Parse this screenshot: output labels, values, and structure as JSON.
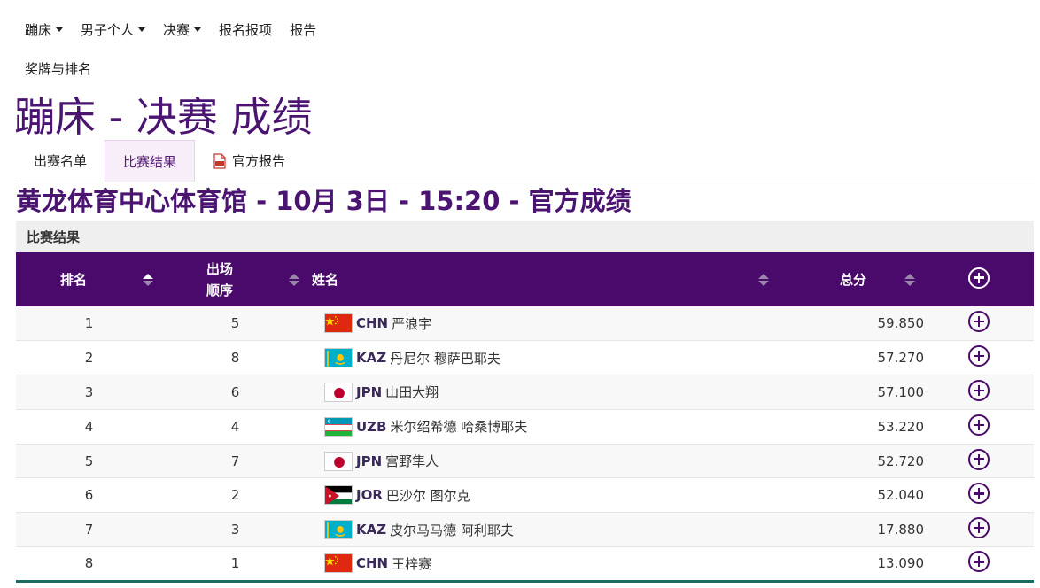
{
  "nav": {
    "items": [
      {
        "label": "蹦床",
        "dropdown": true
      },
      {
        "label": "男子个人",
        "dropdown": true
      },
      {
        "label": "决赛",
        "dropdown": true
      },
      {
        "label": "报名报项",
        "dropdown": false
      },
      {
        "label": "报告",
        "dropdown": false
      }
    ],
    "sub": "奖牌与排名"
  },
  "page_title": "蹦床 - 决赛 成绩",
  "tabs": [
    {
      "label": "出赛名单",
      "active": false
    },
    {
      "label": "比赛结果",
      "active": true
    },
    {
      "label": "官方报告",
      "active": false,
      "icon": "pdf-icon"
    }
  ],
  "venue": "黄龙体育中心体育馆 - 10月 3日 - 15:20 - 官方成绩",
  "section_label": "比赛结果",
  "table": {
    "headers": {
      "rank": "排名",
      "order_line1": "出场",
      "order_line2": "顺序",
      "name": "姓名",
      "score": "总分"
    },
    "rows": [
      {
        "rank": "1",
        "order": "5",
        "noc": "CHN",
        "name": "严浪宇",
        "score": "59.850"
      },
      {
        "rank": "2",
        "order": "8",
        "noc": "KAZ",
        "name": "丹尼尔 穆萨巴耶夫",
        "score": "57.270"
      },
      {
        "rank": "3",
        "order": "6",
        "noc": "JPN",
        "name": "山田大翔",
        "score": "57.100"
      },
      {
        "rank": "4",
        "order": "4",
        "noc": "UZB",
        "name": "米尔绍希德 哈桑博耶夫",
        "score": "53.220"
      },
      {
        "rank": "5",
        "order": "7",
        "noc": "JPN",
        "name": "宫野隼人",
        "score": "52.720"
      },
      {
        "rank": "6",
        "order": "2",
        "noc": "JOR",
        "name": "巴沙尔 图尔克",
        "score": "52.040"
      },
      {
        "rank": "7",
        "order": "3",
        "noc": "KAZ",
        "name": "皮尔马马德 阿利耶夫",
        "score": "17.880"
      },
      {
        "rank": "8",
        "order": "1",
        "noc": "CHN",
        "name": "王梓赛",
        "score": "13.090"
      }
    ]
  },
  "colors": {
    "brand_purple": "#4a0a6c",
    "title_purple": "#4a1470",
    "footer_teal": "#1b6b63"
  }
}
